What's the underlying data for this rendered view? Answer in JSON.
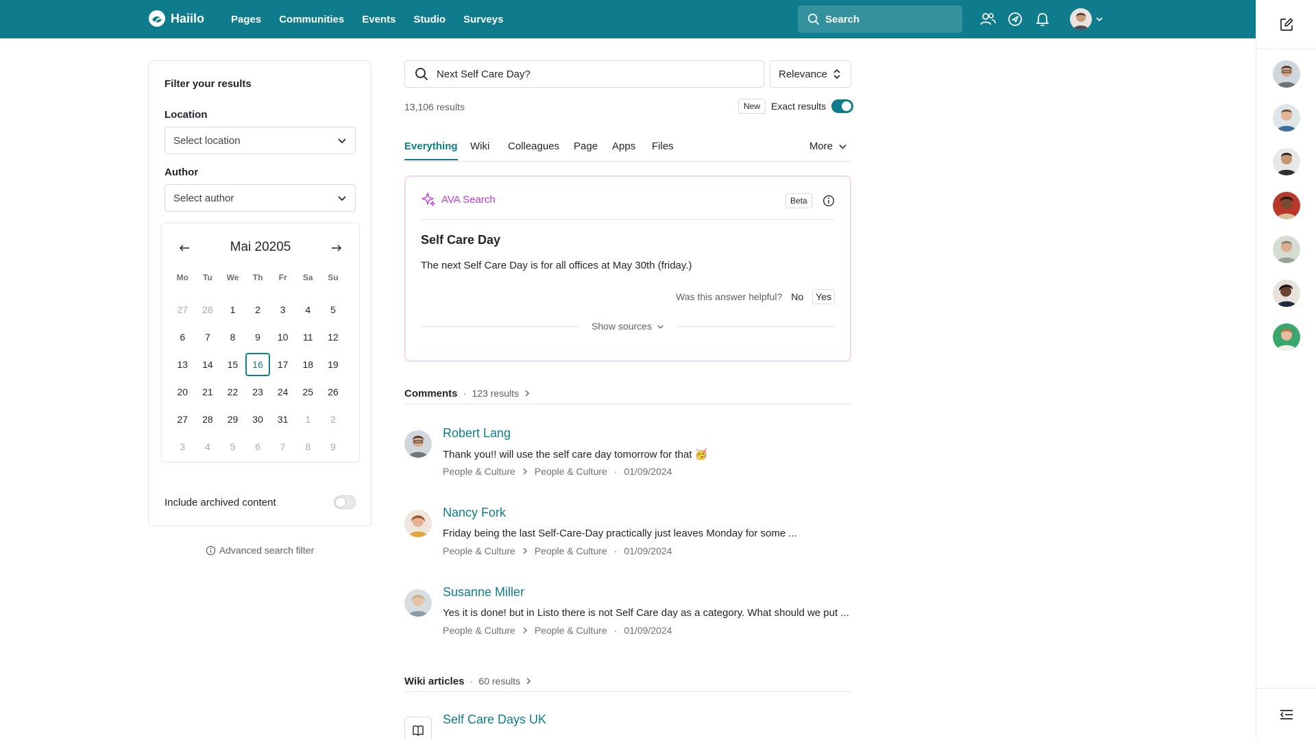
{
  "app": {
    "name": "Haiilo",
    "nav": [
      "Pages",
      "Communities",
      "Events",
      "Studio",
      "Surveys"
    ],
    "search_label": "Search",
    "accent": "#0e7c8c"
  },
  "filters": {
    "title": "Filter your results",
    "location_label": "Location",
    "location_value": "Select location",
    "author_label": "Author",
    "author_value": "Select author",
    "calendar": {
      "month_label": "Mai 20205",
      "weekdays": [
        "Mo",
        "Tu",
        "We",
        "Th",
        "Fr",
        "Sa",
        "Su"
      ],
      "days": [
        {
          "d": "27",
          "muted": true
        },
        {
          "d": "28",
          "muted": true
        },
        {
          "d": "1"
        },
        {
          "d": "2"
        },
        {
          "d": "3"
        },
        {
          "d": "4"
        },
        {
          "d": "5"
        },
        {
          "d": "6"
        },
        {
          "d": "7"
        },
        {
          "d": "8"
        },
        {
          "d": "9"
        },
        {
          "d": "10"
        },
        {
          "d": "11"
        },
        {
          "d": "12"
        },
        {
          "d": "13"
        },
        {
          "d": "14"
        },
        {
          "d": "15"
        },
        {
          "d": "16",
          "selected": true
        },
        {
          "d": "17"
        },
        {
          "d": "18"
        },
        {
          "d": "19"
        },
        {
          "d": "20"
        },
        {
          "d": "21"
        },
        {
          "d": "22"
        },
        {
          "d": "23"
        },
        {
          "d": "24"
        },
        {
          "d": "25"
        },
        {
          "d": "26"
        },
        {
          "d": "27"
        },
        {
          "d": "28"
        },
        {
          "d": "29"
        },
        {
          "d": "30"
        },
        {
          "d": "31"
        },
        {
          "d": "1",
          "muted": true
        },
        {
          "d": "2",
          "muted": true
        },
        {
          "d": "3",
          "muted": true
        },
        {
          "d": "4",
          "muted": true
        },
        {
          "d": "5",
          "muted": true
        },
        {
          "d": "6",
          "muted": true
        },
        {
          "d": "7",
          "muted": true
        },
        {
          "d": "8",
          "muted": true
        },
        {
          "d": "9",
          "muted": true
        }
      ]
    },
    "archived_label": "Include archived content",
    "archived_on": false,
    "advanced_label": "Advanced search filter"
  },
  "search": {
    "query": "Next Self Care Day?",
    "sort_label": "Relevance",
    "results_count": "13,106 results",
    "new_badge": "New",
    "exact_label": "Exact results",
    "exact_on": true
  },
  "tabs": [
    "Everything",
    "Wiki",
    "Colleagues",
    "Page",
    "Apps",
    "Files"
  ],
  "tabs_more": "More",
  "ava": {
    "label": "AVA Search",
    "badge": "Beta",
    "title": "Self Care Day",
    "answer": "The next Self Care Day is for all offices at May 30th (friday.)",
    "helpful_q": "Was this answer helpful?",
    "no": "No",
    "yes": "Yes",
    "sources": "Show sources"
  },
  "comments": {
    "heading": "Comments",
    "count": "123 results",
    "items": [
      {
        "name": "Robert Lang",
        "text": "Thank you!! will use the self care day tomorrow for that 🥳",
        "crumb1": "People & Culture",
        "crumb2": "People & Culture",
        "date": "01/09/2024"
      },
      {
        "name": "Nancy Fork",
        "text": "Friday being the last Self-Care-Day practically just leaves Monday for some ...",
        "crumb1": "People & Culture",
        "crumb2": "People & Culture",
        "date": "01/09/2024"
      },
      {
        "name": "Susanne Miller",
        "text": "Yes it is done! but in Listo there is not Self Care day as a category. What should we put ...",
        "crumb1": "People & Culture",
        "crumb2": "People & Culture",
        "date": "01/09/2024"
      }
    ]
  },
  "wiki": {
    "heading": "Wiki articles",
    "count": "60 results",
    "first_title": "Self Care Days UK"
  }
}
